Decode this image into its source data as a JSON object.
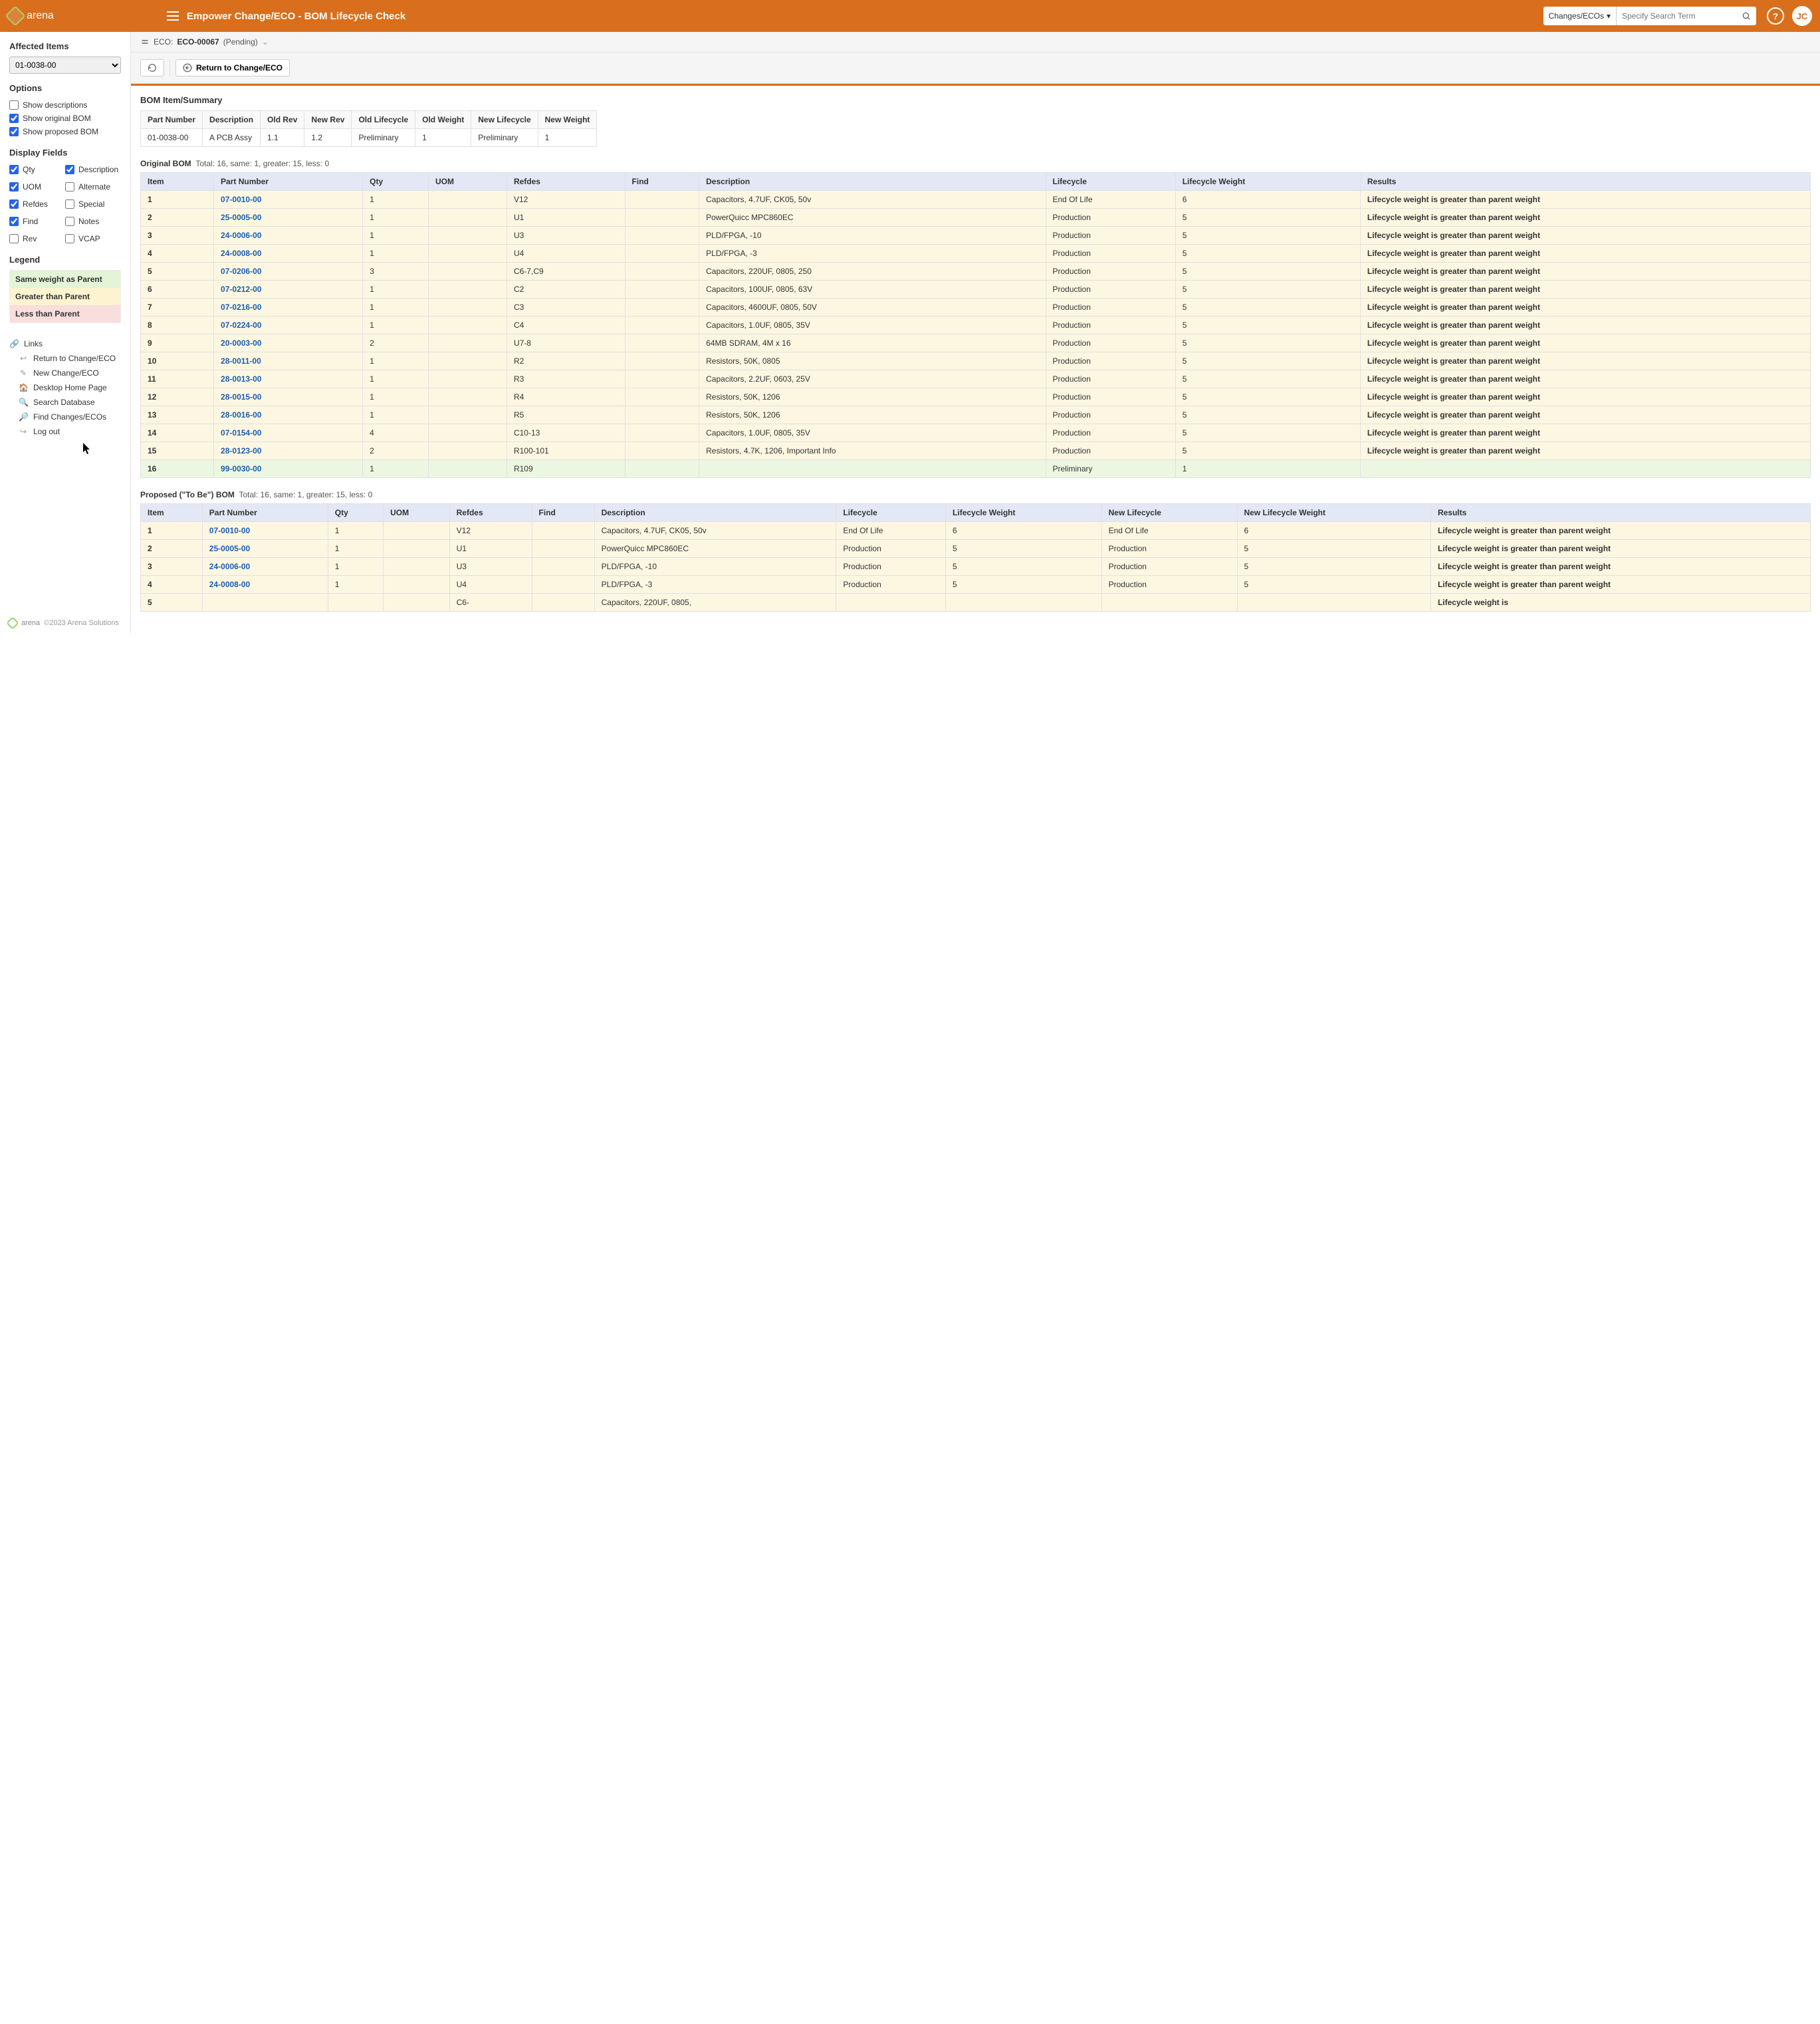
{
  "header": {
    "brand": "arena",
    "title": "Empower Change/ECO - BOM Lifecycle Check",
    "searchCategory": "Changes/ECOs",
    "searchPlaceholder": "Specify Search Term",
    "avatar": "JC"
  },
  "breadcrumb": {
    "prefix": "ECO:",
    "id": "ECO-00067",
    "status": "(Pending)"
  },
  "toolbar": {
    "return": "Return to Change/ECO"
  },
  "sidebar": {
    "affectedHeading": "Affected Items",
    "affectedValue": "01-0038-00",
    "optionsHeading": "Options",
    "options": [
      {
        "label": "Show descriptions",
        "checked": false
      },
      {
        "label": "Show original BOM",
        "checked": true
      },
      {
        "label": "Show proposed BOM",
        "checked": true
      }
    ],
    "displayHeading": "Display Fields",
    "display": [
      {
        "label": "Qty",
        "checked": true
      },
      {
        "label": "Description",
        "checked": true
      },
      {
        "label": "UOM",
        "checked": true
      },
      {
        "label": "Alternate",
        "checked": false
      },
      {
        "label": "Refdes",
        "checked": true
      },
      {
        "label": "Special",
        "checked": false
      },
      {
        "label": "Find",
        "checked": true
      },
      {
        "label": "Notes",
        "checked": false
      },
      {
        "label": "Rev",
        "checked": false
      },
      {
        "label": "VCAP",
        "checked": false
      }
    ],
    "legendHeading": "Legend",
    "legend": {
      "same": "Same weight as Parent",
      "greater": "Greater than Parent",
      "less": "Less than Parent"
    },
    "linksHeading": "Links",
    "links": [
      "Return to Change/ECO",
      "New Change/ECO",
      "Desktop Home Page",
      "Search Database",
      "Find Changes/ECOs",
      "Log out"
    ],
    "copyright": "©2023 Arena Solutions"
  },
  "summary": {
    "title": "BOM Item/Summary",
    "headers": [
      "Part Number",
      "Description",
      "Old Rev",
      "New Rev",
      "Old Lifecycle",
      "Old Weight",
      "New Lifecycle",
      "New Weight"
    ],
    "row": [
      "01-0038-00",
      "A PCB Assy",
      "1.1",
      "1.2",
      "Preliminary",
      "1",
      "Preliminary",
      "1"
    ]
  },
  "original": {
    "title": "Original BOM",
    "stats": "Total: 16, same: 1, greater: 15, less: 0",
    "headers": [
      "Item",
      "Part Number",
      "Qty",
      "UOM",
      "Refdes",
      "Find",
      "Description",
      "Lifecycle",
      "Lifecycle Weight",
      "Results"
    ],
    "rows": [
      {
        "cls": "greater",
        "c": [
          "1",
          "07-0010-00",
          "1",
          "",
          "V12",
          "",
          "Capacitors, 4.7UF, CK05, 50v",
          "End Of Life",
          "6",
          "Lifecycle weight is greater than parent weight"
        ]
      },
      {
        "cls": "greater",
        "c": [
          "2",
          "25-0005-00",
          "1",
          "",
          "U1",
          "",
          "PowerQuicc MPC860EC",
          "Production",
          "5",
          "Lifecycle weight is greater than parent weight"
        ]
      },
      {
        "cls": "greater",
        "c": [
          "3",
          "24-0006-00",
          "1",
          "",
          "U3",
          "",
          "PLD/FPGA, -10",
          "Production",
          "5",
          "Lifecycle weight is greater than parent weight"
        ]
      },
      {
        "cls": "greater",
        "c": [
          "4",
          "24-0008-00",
          "1",
          "",
          "U4",
          "",
          "PLD/FPGA, -3",
          "Production",
          "5",
          "Lifecycle weight is greater than parent weight"
        ]
      },
      {
        "cls": "greater",
        "c": [
          "5",
          "07-0206-00",
          "3",
          "",
          "C6-7,C9",
          "",
          "Capacitors, 220UF, 0805, 250",
          "Production",
          "5",
          "Lifecycle weight is greater than parent weight"
        ]
      },
      {
        "cls": "greater",
        "c": [
          "6",
          "07-0212-00",
          "1",
          "",
          "C2",
          "",
          "Capacitors, 100UF, 0805, 63V",
          "Production",
          "5",
          "Lifecycle weight is greater than parent weight"
        ]
      },
      {
        "cls": "greater",
        "c": [
          "7",
          "07-0216-00",
          "1",
          "",
          "C3",
          "",
          "Capacitors, 4600UF, 0805, 50V",
          "Production",
          "5",
          "Lifecycle weight is greater than parent weight"
        ]
      },
      {
        "cls": "greater",
        "c": [
          "8",
          "07-0224-00",
          "1",
          "",
          "C4",
          "",
          "Capacitors, 1.0UF, 0805, 35V",
          "Production",
          "5",
          "Lifecycle weight is greater than parent weight"
        ]
      },
      {
        "cls": "greater",
        "c": [
          "9",
          "20-0003-00",
          "2",
          "",
          "U7-8",
          "",
          "64MB SDRAM, 4M x 16",
          "Production",
          "5",
          "Lifecycle weight is greater than parent weight"
        ]
      },
      {
        "cls": "greater",
        "c": [
          "10",
          "28-0011-00",
          "1",
          "",
          "R2",
          "",
          "Resistors, 50K, 0805",
          "Production",
          "5",
          "Lifecycle weight is greater than parent weight"
        ]
      },
      {
        "cls": "greater",
        "c": [
          "11",
          "28-0013-00",
          "1",
          "",
          "R3",
          "",
          "Capacitors, 2.2UF, 0603, 25V",
          "Production",
          "5",
          "Lifecycle weight is greater than parent weight"
        ]
      },
      {
        "cls": "greater",
        "c": [
          "12",
          "28-0015-00",
          "1",
          "",
          "R4",
          "",
          "Resistors, 50K, 1206",
          "Production",
          "5",
          "Lifecycle weight is greater than parent weight"
        ]
      },
      {
        "cls": "greater",
        "c": [
          "13",
          "28-0016-00",
          "1",
          "",
          "R5",
          "",
          "Resistors, 50K, 1206",
          "Production",
          "5",
          "Lifecycle weight is greater than parent weight"
        ]
      },
      {
        "cls": "greater",
        "c": [
          "14",
          "07-0154-00",
          "4",
          "",
          "C10-13",
          "",
          "Capacitors, 1.0UF, 0805, 35V",
          "Production",
          "5",
          "Lifecycle weight is greater than parent weight"
        ]
      },
      {
        "cls": "greater",
        "c": [
          "15",
          "28-0123-00",
          "2",
          "",
          "R100-101",
          "",
          "Resistors, 4.7K, 1206, Important Info",
          "Production",
          "5",
          "Lifecycle weight is greater than parent weight"
        ]
      },
      {
        "cls": "same",
        "c": [
          "16",
          "99-0030-00",
          "1",
          "",
          "R109",
          "",
          "",
          "Preliminary",
          "1",
          ""
        ]
      }
    ]
  },
  "proposed": {
    "title": "Proposed (\"To Be\") BOM",
    "stats": "Total: 16, same: 1, greater: 15, less: 0",
    "headers": [
      "Item",
      "Part Number",
      "Qty",
      "UOM",
      "Refdes",
      "Find",
      "Description",
      "Lifecycle",
      "Lifecycle Weight",
      "New Lifecycle",
      "New Lifecycle Weight",
      "Results"
    ],
    "rows": [
      {
        "cls": "greater",
        "c": [
          "1",
          "07-0010-00",
          "1",
          "",
          "V12",
          "",
          "Capacitors, 4.7UF, CK05, 50v",
          "End Of Life",
          "6",
          "End Of Life",
          "6",
          "Lifecycle weight is greater than parent weight"
        ]
      },
      {
        "cls": "greater",
        "c": [
          "2",
          "25-0005-00",
          "1",
          "",
          "U1",
          "",
          "PowerQuicc MPC860EC",
          "Production",
          "5",
          "Production",
          "5",
          "Lifecycle weight is greater than parent weight"
        ]
      },
      {
        "cls": "greater",
        "c": [
          "3",
          "24-0006-00",
          "1",
          "",
          "U3",
          "",
          "PLD/FPGA, -10",
          "Production",
          "5",
          "Production",
          "5",
          "Lifecycle weight is greater than parent weight"
        ]
      },
      {
        "cls": "greater",
        "c": [
          "4",
          "24-0008-00",
          "1",
          "",
          "U4",
          "",
          "PLD/FPGA, -3",
          "Production",
          "5",
          "Production",
          "5",
          "Lifecycle weight is greater than parent weight"
        ]
      },
      {
        "cls": "greater",
        "c": [
          "5",
          "",
          "",
          "",
          "C6-",
          "",
          "Capacitors, 220UF, 0805,",
          "",
          "",
          "",
          "",
          "Lifecycle weight is"
        ]
      }
    ]
  }
}
